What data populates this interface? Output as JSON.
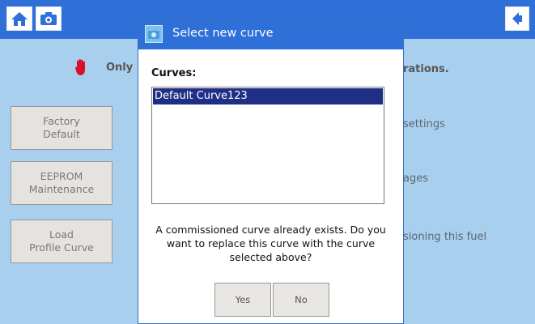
{
  "topbar": {
    "title": ""
  },
  "background": {
    "warning_text": "Only",
    "warning_tail": "rations.",
    "buttons": [
      {
        "line1": "Factory",
        "line2": "Default",
        "desc": "settings"
      },
      {
        "line1": "EEPROM",
        "line2": "Maintenance",
        "desc": "ages"
      },
      {
        "line1": "Load",
        "line2": "Profile Curve",
        "desc": "sioning this fuel"
      }
    ]
  },
  "dialog": {
    "title": "Select new curve",
    "curves_label": "Curves:",
    "curves": [
      "Default Curve123"
    ],
    "message": "A commissioned curve already exists. Do you want to replace this curve with the curve selected above?",
    "yes_label": "Yes",
    "no_label": "No"
  },
  "icons": [
    "home-icon",
    "camera-icon",
    "back-icon",
    "hand-stop-icon",
    "dialog-camera-icon"
  ],
  "colors": {
    "titlebar": "#2f6fd8",
    "background": "#a9cfef",
    "selection": "#1f2f86"
  }
}
